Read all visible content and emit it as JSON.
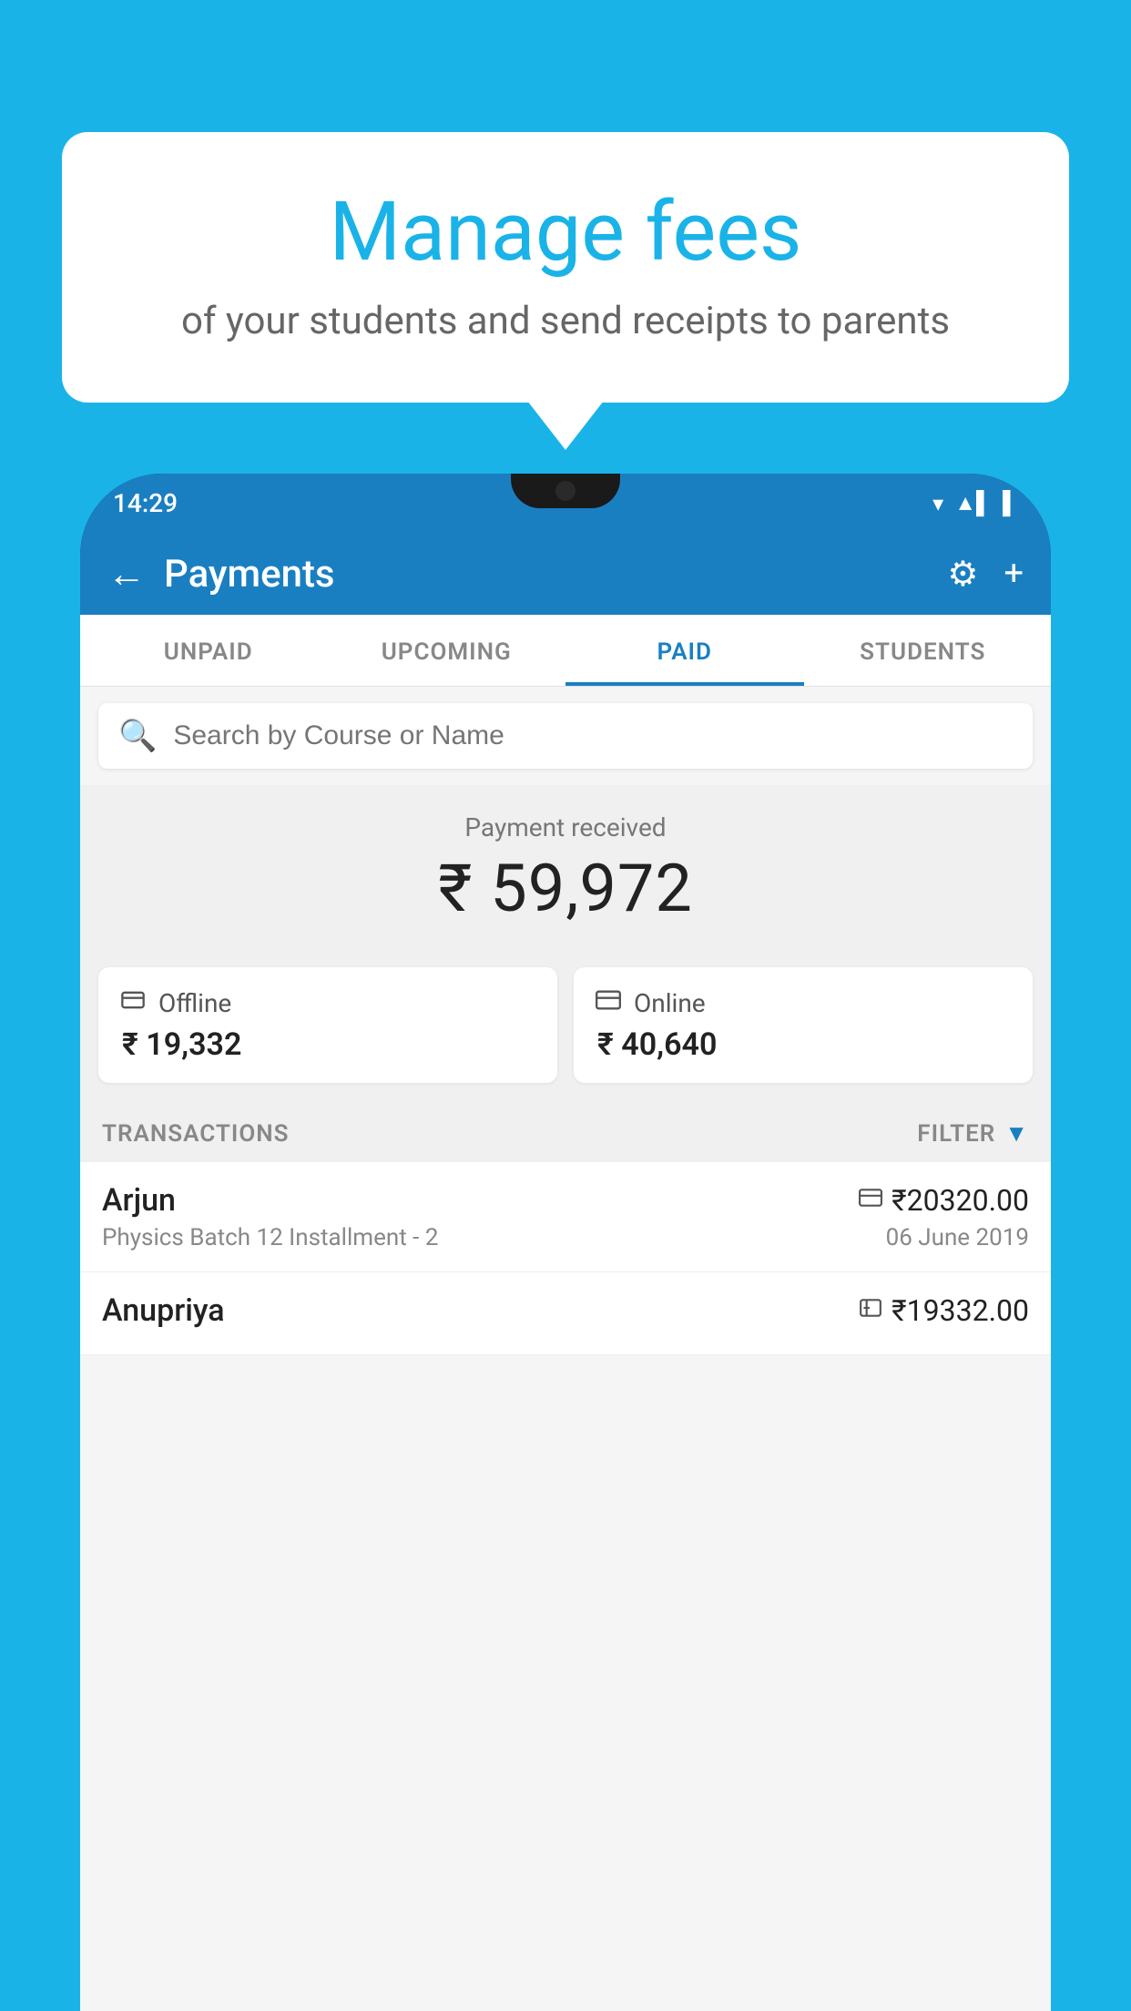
{
  "page": {
    "bg_color": "#1ab3e8"
  },
  "speech_bubble": {
    "title": "Manage fees",
    "subtitle": "of your students and send receipts to parents"
  },
  "phone": {
    "status_bar": {
      "time": "14:29",
      "signal_icon": "▼▲▌",
      "battery_icon": "▌"
    },
    "header": {
      "back_label": "←",
      "title": "Payments",
      "settings_label": "⚙",
      "add_label": "+"
    },
    "tabs": [
      {
        "label": "UNPAID",
        "active": false
      },
      {
        "label": "UPCOMING",
        "active": false
      },
      {
        "label": "PAID",
        "active": true
      },
      {
        "label": "STUDENTS",
        "active": false
      }
    ],
    "search": {
      "placeholder": "Search by Course or Name",
      "icon": "🔍"
    },
    "payment_summary": {
      "label": "Payment received",
      "amount": "₹ 59,972",
      "offline": {
        "icon": "₹",
        "type": "Offline",
        "amount": "₹ 19,332"
      },
      "online": {
        "icon": "💳",
        "type": "Online",
        "amount": "₹ 40,640"
      }
    },
    "transactions": {
      "label": "TRANSACTIONS",
      "filter_label": "FILTER",
      "items": [
        {
          "name": "Arjun",
          "type_icon": "💳",
          "amount": "₹20320.00",
          "course": "Physics Batch 12 Installment - 2",
          "date": "06 June 2019"
        },
        {
          "name": "Anupriya",
          "type_icon": "₹",
          "amount": "₹19332.00",
          "course": "",
          "date": ""
        }
      ]
    }
  }
}
